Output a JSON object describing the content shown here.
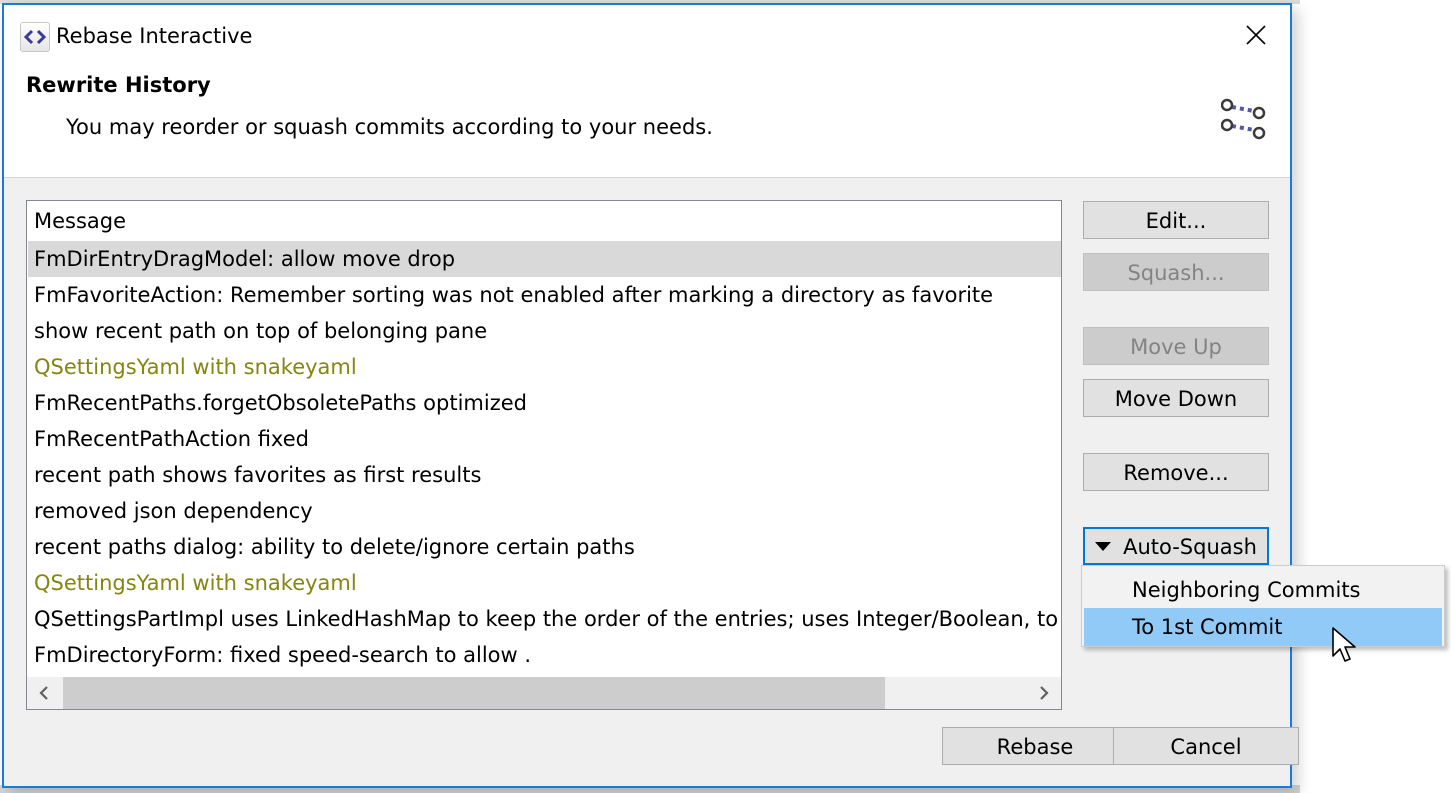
{
  "window": {
    "title": "Rebase Interactive",
    "app_icon": "code-brackets-icon",
    "close_icon": "close-icon"
  },
  "banner": {
    "heading": "Rewrite History",
    "description": "You may reorder or squash commits according to your needs.",
    "icon": "git-rebase-graph-icon"
  },
  "table": {
    "column_header": "Message",
    "rows": [
      {
        "message": "FmDirEntryDragModel: allow move drop",
        "selected": true,
        "fixup": false
      },
      {
        "message": "FmFavoriteAction: Remember sorting was not enabled after marking a directory as favorite",
        "selected": false,
        "fixup": false
      },
      {
        "message": "show recent path on top of belonging pane",
        "selected": false,
        "fixup": false
      },
      {
        "message": "QSettingsYaml with snakeyaml",
        "selected": false,
        "fixup": true
      },
      {
        "message": "FmRecentPaths.forgetObsoletePaths optimized",
        "selected": false,
        "fixup": false
      },
      {
        "message": "FmRecentPathAction fixed",
        "selected": false,
        "fixup": false
      },
      {
        "message": "recent path shows favorites as first results",
        "selected": false,
        "fixup": false
      },
      {
        "message": "removed json dependency",
        "selected": false,
        "fixup": false
      },
      {
        "message": "recent paths dialog: ability to delete/ignore certain paths",
        "selected": false,
        "fixup": false
      },
      {
        "message": "QSettingsYaml with snakeyaml",
        "selected": false,
        "fixup": true
      },
      {
        "message": "QSettingsPartImpl uses LinkedHashMap to keep the order of the entries; uses Integer/Boolean, to",
        "selected": false,
        "fixup": false
      },
      {
        "message": "FmDirectoryForm: fixed speed-search to allow .",
        "selected": false,
        "fixup": false
      }
    ],
    "scroll_left_icon": "chevron-left-icon",
    "scroll_right_icon": "chevron-right-icon"
  },
  "buttons": {
    "edit": "Edit...",
    "squash": "Squash...",
    "move_up": "Move Up",
    "move_down": "Move Down",
    "remove": "Remove...",
    "auto_squash": "Auto-Squash",
    "rebase": "Rebase",
    "cancel": "Cancel"
  },
  "auto_squash_menu": {
    "items": [
      {
        "label": "Neighboring Commits",
        "highlighted": false
      },
      {
        "label": "To 1st Commit",
        "highlighted": true
      }
    ]
  },
  "colors": {
    "window_border": "#1c7cd5",
    "fixup_text": "#858512",
    "selected_row": "#d9d9d9",
    "menu_highlight": "#91c9f7"
  }
}
